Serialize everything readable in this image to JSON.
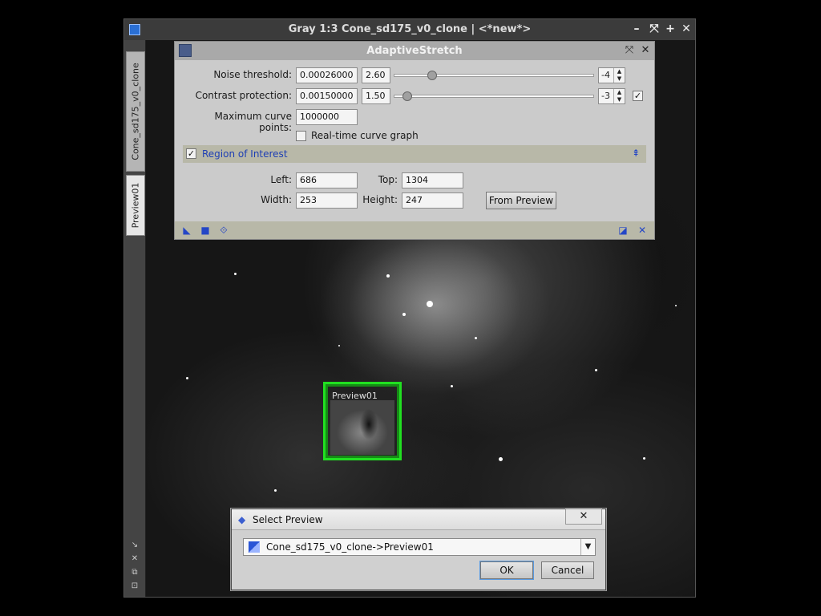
{
  "image_window": {
    "title": "Gray 1:3 Cone_sd175_v0_clone | <*new*>",
    "controls": [
      "–",
      "⤧",
      "+",
      "✕"
    ],
    "tabs": [
      {
        "label": "Cone_sd175_v0_clone"
      },
      {
        "label": "Preview01"
      }
    ],
    "strip_icons": [
      "↘",
      "✕",
      "⧉",
      "⊡"
    ],
    "preview_label": "Preview01"
  },
  "adaptive_stretch": {
    "title": "AdaptiveStretch",
    "controls": [
      "⤧",
      "✕"
    ],
    "noise_threshold": {
      "label": "Noise threshold:",
      "value": "0.00026000",
      "mantissa": "2.60",
      "exponent": "-4",
      "slider_fraction": 0.19
    },
    "contrast_protection": {
      "label": "Contrast protection:",
      "value": "0.00150000",
      "mantissa": "1.50",
      "exponent": "-3",
      "slider_fraction": 0.06,
      "enabled": true
    },
    "max_curve_points": {
      "label": "Maximum curve points:",
      "value": "1000000"
    },
    "realtime_graph": {
      "label": "Real-time curve graph",
      "checked": false
    },
    "roi": {
      "title": "Region of Interest",
      "enabled": true,
      "left_label": "Left:",
      "left_value": "686",
      "top_label": "Top:",
      "top_value": "1304",
      "width_label": "Width:",
      "width_value": "253",
      "height_label": "Height:",
      "height_value": "247",
      "from_preview_label": "From Preview"
    },
    "footer_icons": [
      "◣",
      "■",
      "⟐",
      "◪",
      "✕"
    ]
  },
  "select_preview": {
    "title": "Select Preview",
    "close": "✕",
    "selected": "Cone_sd175_v0_clone->Preview01",
    "ok_label": "OK",
    "cancel_label": "Cancel"
  }
}
